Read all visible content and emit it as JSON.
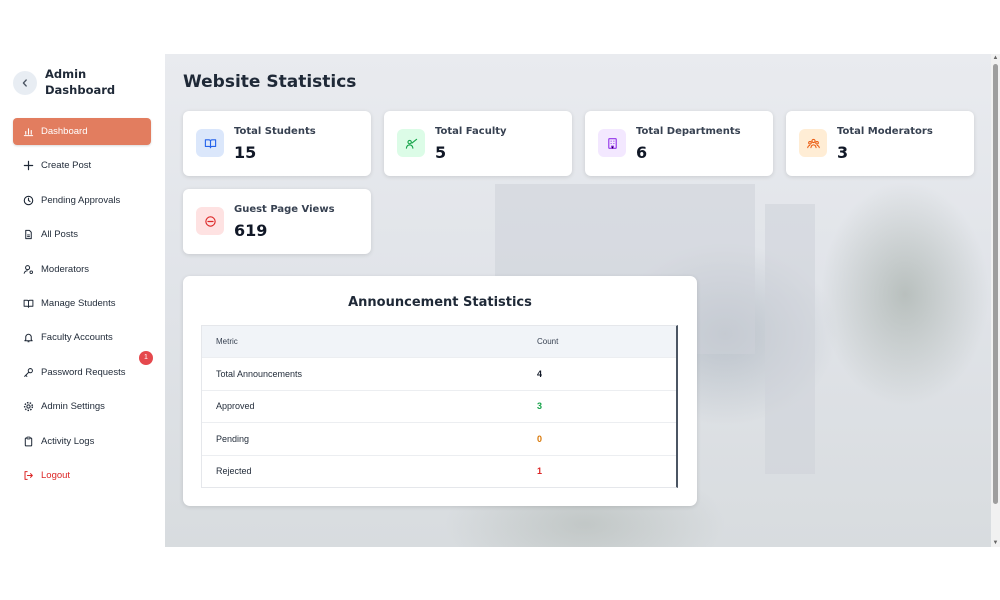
{
  "sidebar": {
    "title": "Admin Dashboard",
    "items": [
      {
        "label": "Dashboard",
        "icon": "bar-chart-icon"
      },
      {
        "label": "Create Post",
        "icon": "plus-icon"
      },
      {
        "label": "Pending Approvals",
        "icon": "clock-icon"
      },
      {
        "label": "All Posts",
        "icon": "document-icon"
      },
      {
        "label": "Moderators",
        "icon": "user-cog-icon"
      },
      {
        "label": "Manage Students",
        "icon": "book-icon"
      },
      {
        "label": "Faculty Accounts",
        "icon": "bell-icon"
      },
      {
        "label": "Password Requests",
        "icon": "key-icon",
        "badge": "1"
      },
      {
        "label": "Admin Settings",
        "icon": "gear-icon"
      },
      {
        "label": "Activity Logs",
        "icon": "clipboard-icon"
      },
      {
        "label": "Logout",
        "icon": "logout-icon"
      }
    ],
    "active_color": "#e27d5f",
    "logout_color": "#dc2626",
    "badge_color": "#e5484d"
  },
  "main": {
    "title": "Website Statistics",
    "cards": [
      {
        "label": "Total Students",
        "value": "15",
        "icon": "book-icon",
        "bg": "#dbe7fb",
        "fg": "#2563eb"
      },
      {
        "label": "Total Faculty",
        "value": "5",
        "icon": "teacher-icon",
        "bg": "#dcfce7",
        "fg": "#16a34a"
      },
      {
        "label": "Total Departments",
        "value": "6",
        "icon": "building-icon",
        "bg": "#f3e8ff",
        "fg": "#9333ea"
      },
      {
        "label": "Total Moderators",
        "value": "3",
        "icon": "users-icon",
        "bg": "#ffedd5",
        "fg": "#ea580c"
      },
      {
        "label": "Guest Page Views",
        "value": "619",
        "icon": "no-entry-icon",
        "bg": "#fee2e2",
        "fg": "#dc2626"
      }
    ],
    "announcements": {
      "title": "Announcement Statistics",
      "columns": [
        "Metric",
        "Count"
      ],
      "rows": [
        {
          "metric": "Total Announcements",
          "count": "4",
          "color": "#111827"
        },
        {
          "metric": "Approved",
          "count": "3",
          "color": "#16a34a"
        },
        {
          "metric": "Pending",
          "count": "0",
          "color": "#d97706"
        },
        {
          "metric": "Rejected",
          "count": "1",
          "color": "#dc2626"
        }
      ]
    }
  }
}
